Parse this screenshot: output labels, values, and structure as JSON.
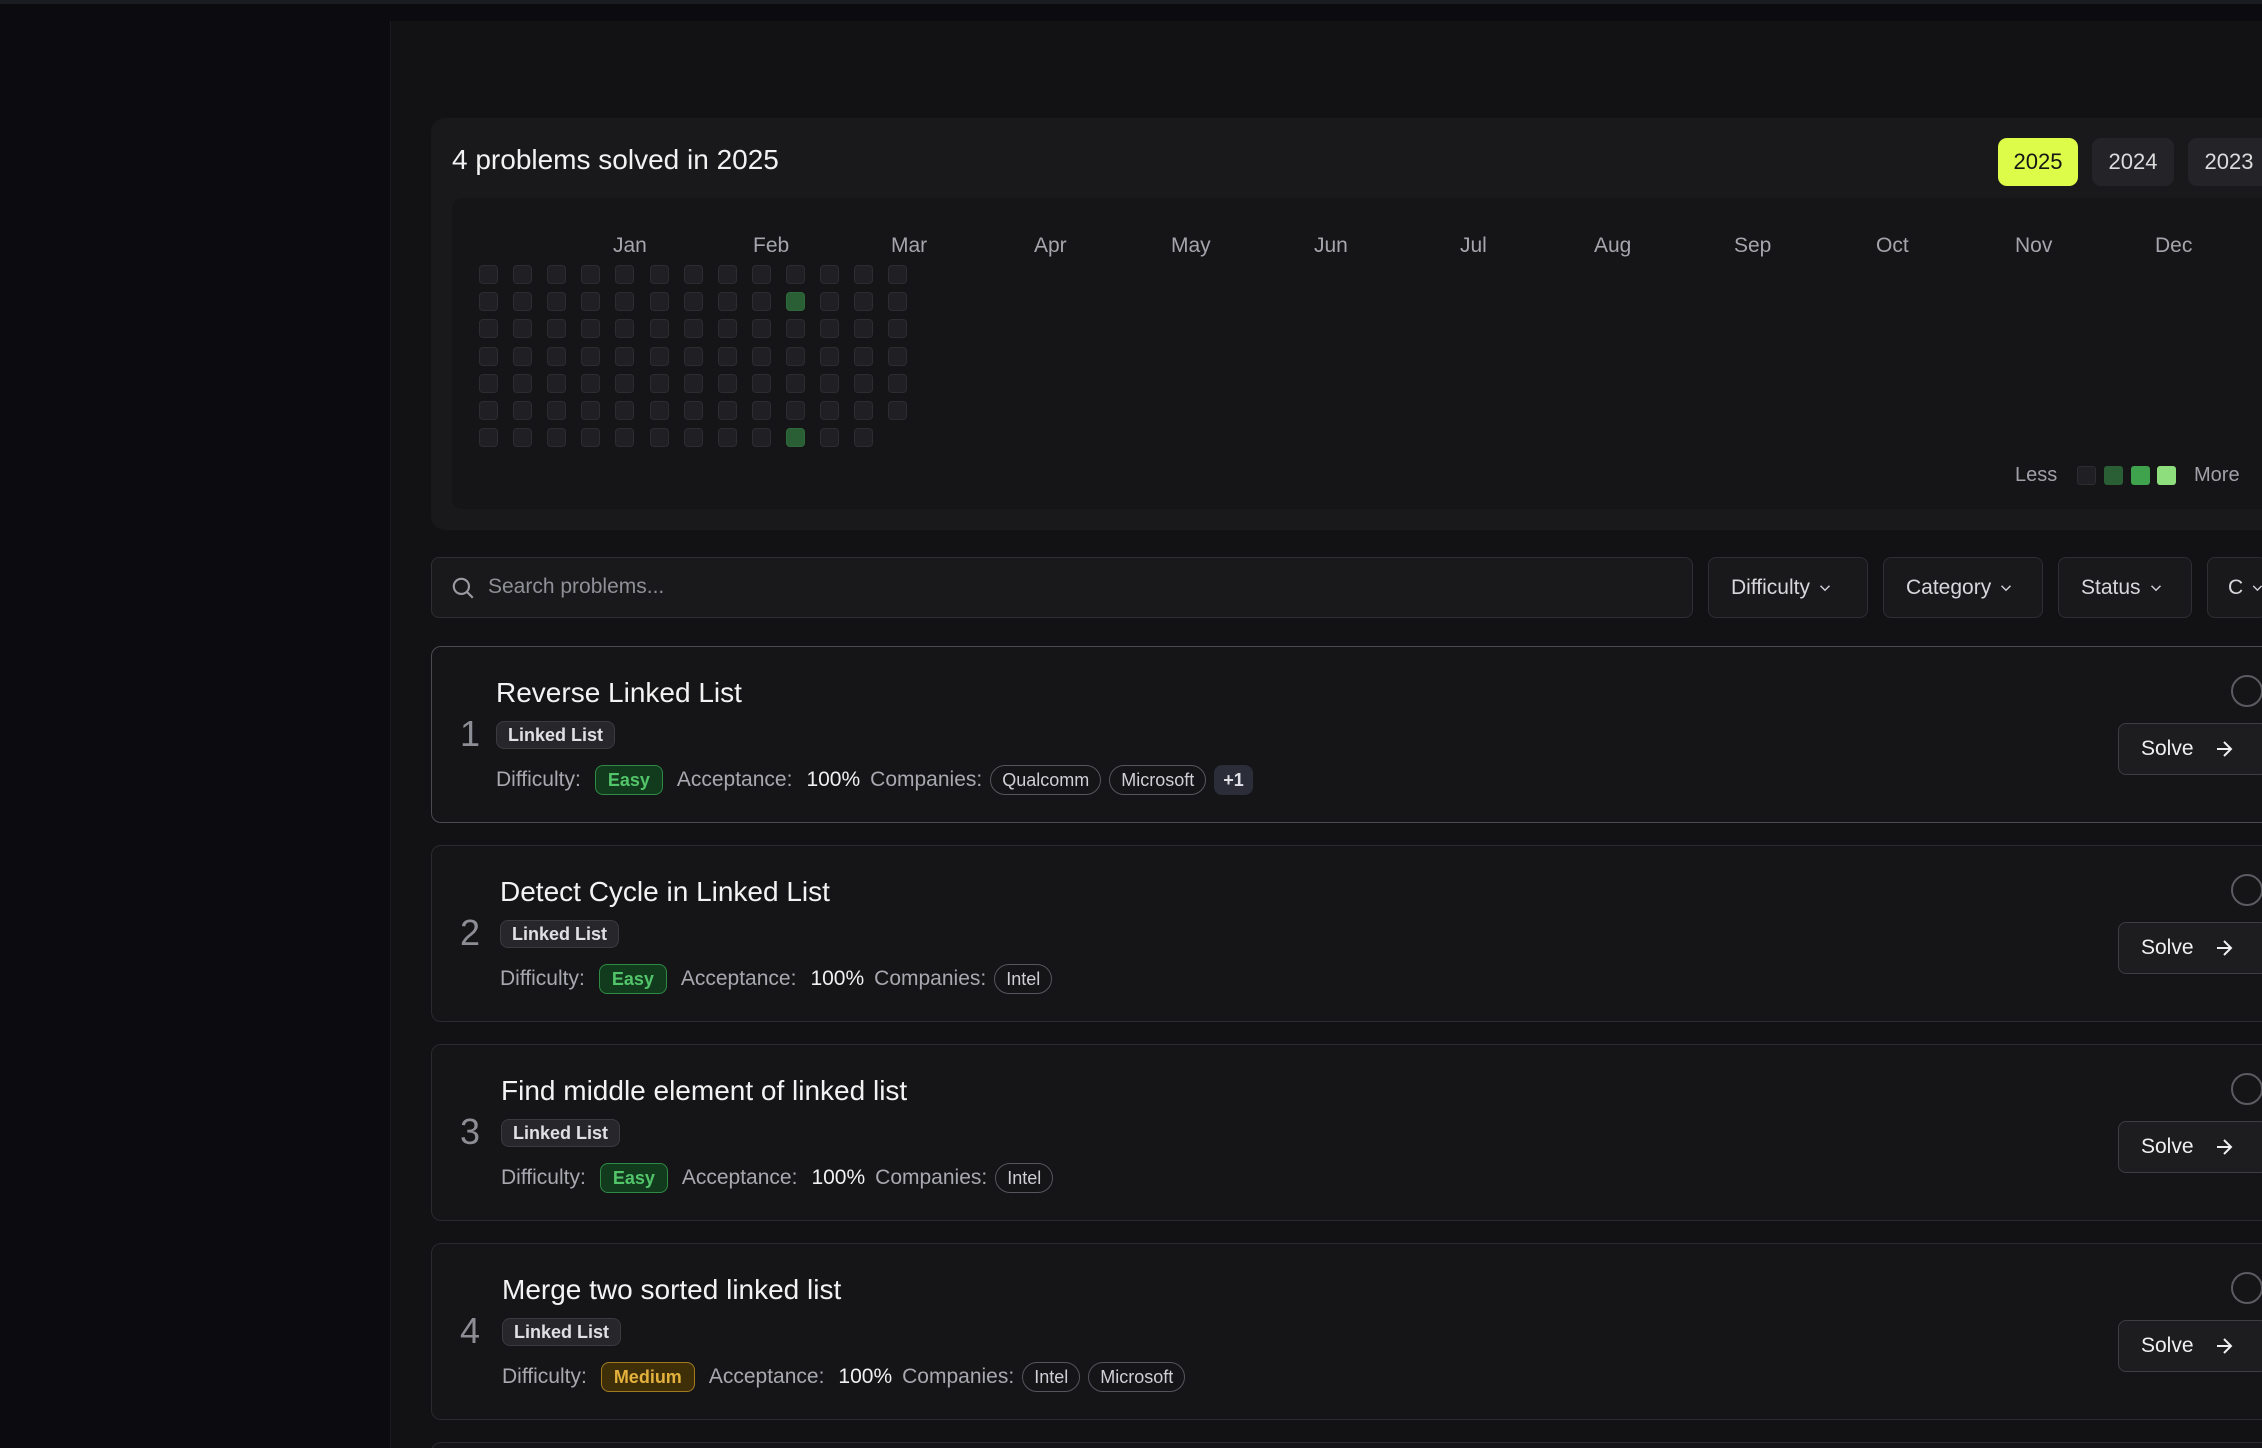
{
  "heatmap": {
    "title": "4 problems solved in 2025",
    "years": [
      "2025",
      "2024",
      "2023"
    ],
    "active_year": "2025",
    "months": [
      "Jan",
      "Feb",
      "Mar",
      "Apr",
      "May",
      "Jun",
      "Jul",
      "Aug",
      "Sep",
      "Oct",
      "Nov",
      "Dec"
    ],
    "legend_less": "Less",
    "legend_more": "More",
    "colors": {
      "empty": "#202024",
      "level1": "#2a5f35",
      "level2": "#3fa34d",
      "level3": "#5cc95f",
      "level4": "#8ede7d"
    }
  },
  "filters": {
    "search_placeholder": "Search problems...",
    "difficulty": "Difficulty",
    "category": "Category",
    "status": "Status",
    "companies": "C"
  },
  "problems": [
    {
      "number": "1",
      "title": "Reverse Linked List",
      "tag": "Linked List",
      "difficulty_label": "Difficulty:",
      "difficulty": "Easy",
      "acceptance_label": "Acceptance:",
      "acceptance": "100%",
      "companies_label": "Companies:",
      "companies": [
        "Qualcomm",
        "Microsoft"
      ],
      "more": "+1",
      "solve": "Solve"
    },
    {
      "number": "2",
      "title": "Detect Cycle in Linked List",
      "tag": "Linked List",
      "difficulty_label": "Difficulty:",
      "difficulty": "Easy",
      "acceptance_label": "Acceptance:",
      "acceptance": "100%",
      "companies_label": "Companies:",
      "companies": [
        "Intel"
      ],
      "solve": "Solve"
    },
    {
      "number": "3",
      "title": "Find middle element of linked list",
      "tag": "Linked List",
      "difficulty_label": "Difficulty:",
      "difficulty": "Easy",
      "acceptance_label": "Acceptance:",
      "acceptance": "100%",
      "companies_label": "Companies:",
      "companies": [
        "Intel"
      ],
      "solve": "Solve"
    },
    {
      "number": "4",
      "title": "Merge two sorted linked list",
      "tag": "Linked List",
      "difficulty_label": "Difficulty:",
      "difficulty": "Medium",
      "acceptance_label": "Acceptance:",
      "acceptance": "100%",
      "companies_label": "Companies:",
      "companies": [
        "Intel",
        "Microsoft"
      ],
      "solve": "Solve"
    }
  ]
}
